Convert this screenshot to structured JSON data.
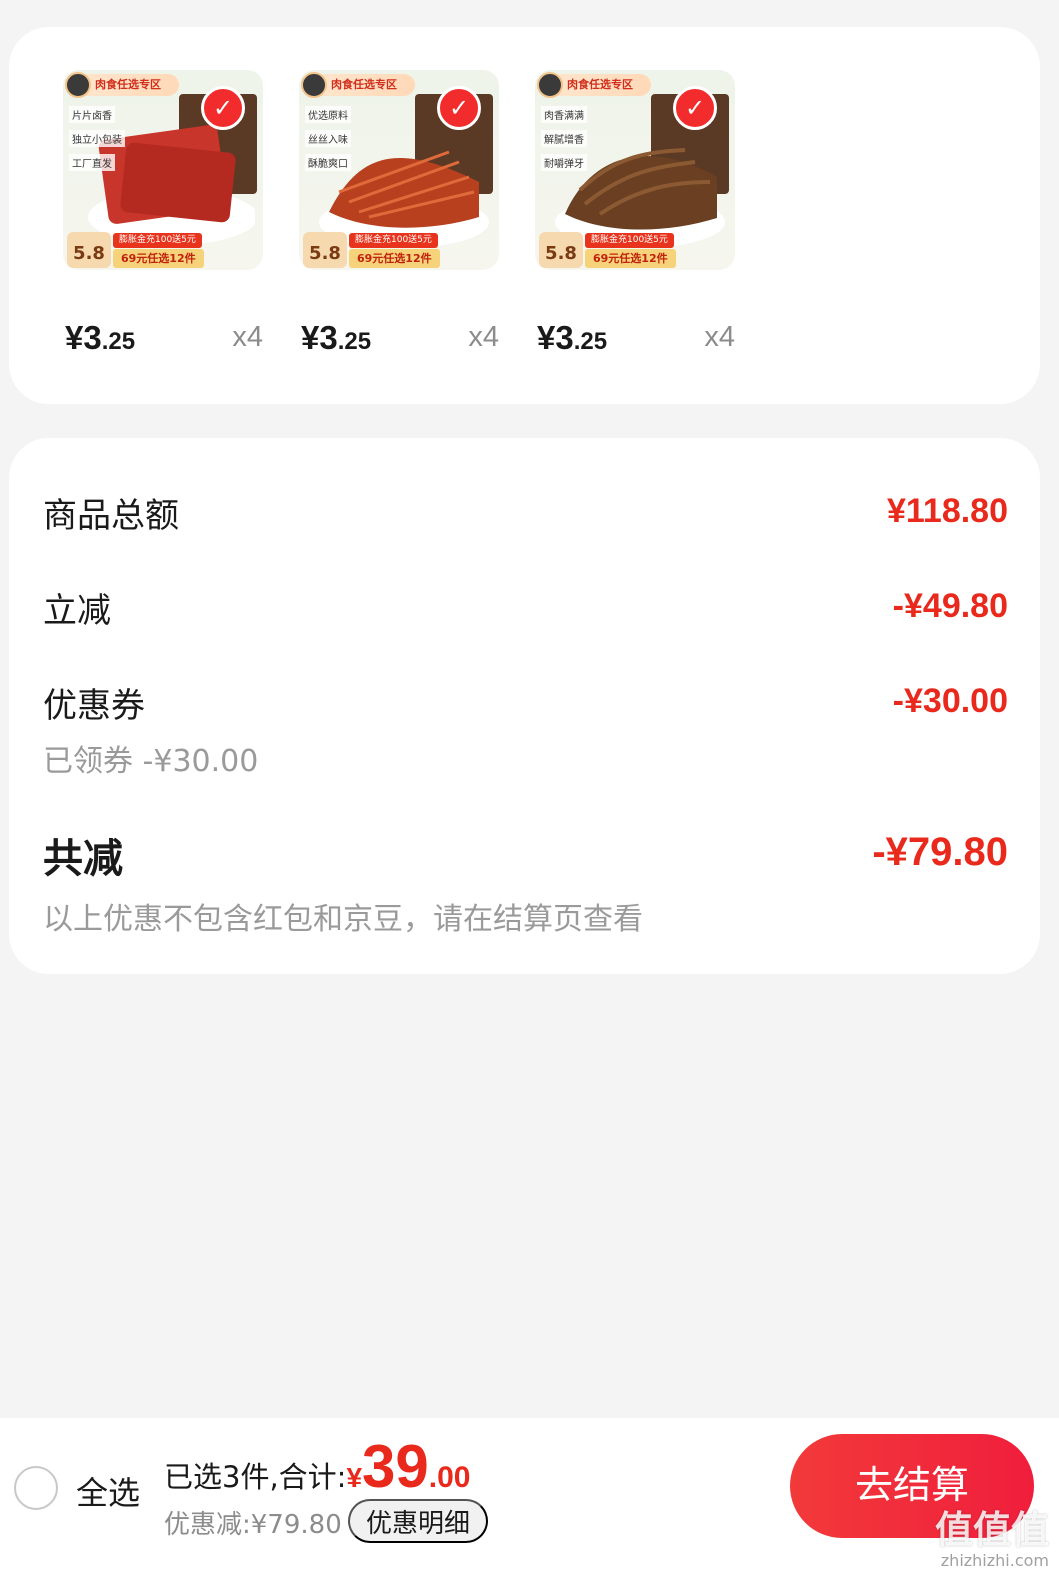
{
  "products": [
    {
      "zone_tag": "肉食任选专区",
      "features": [
        "片片卤香",
        "独立小包装",
        "工厂直发"
      ],
      "ref_price": "5.8",
      "promo_top": "膨胀金充100送5元",
      "promo_bottom": "69元任选12件",
      "price_int": "¥3",
      "price_dec": ".25",
      "qty": "x4",
      "food_color": "#c8352a",
      "selected": true
    },
    {
      "zone_tag": "肉食任选专区",
      "features": [
        "优选原料",
        "丝丝入味",
        "酥脆爽口"
      ],
      "ref_price": "5.8",
      "promo_top": "膨胀金充100送5元",
      "promo_bottom": "69元任选12件",
      "price_int": "¥3",
      "price_dec": ".25",
      "qty": "x4",
      "food_color": "#b8401e",
      "selected": true
    },
    {
      "zone_tag": "肉食任选专区",
      "features": [
        "肉香满满",
        "解腻增香",
        "耐嚼弹牙"
      ],
      "ref_price": "5.8",
      "promo_top": "膨胀金充100送5元",
      "promo_bottom": "69元任选12件",
      "price_int": "¥3",
      "price_dec": ".25",
      "qty": "x4",
      "food_color": "#6b3f22",
      "selected": true
    }
  ],
  "summary": {
    "goods_total_label": "商品总额",
    "goods_total_value": "¥118.80",
    "instant_cut_label": "立减",
    "instant_cut_value": "-¥49.80",
    "coupon_label": "优惠券",
    "coupon_value": "-¥30.00",
    "coupon_sub": "已领券 -¥30.00",
    "total_cut_label": "共减",
    "total_cut_value": "-¥79.80",
    "note": "以上优惠不包含红包和京豆，请在结算页查看"
  },
  "bottom_bar": {
    "select_all": "全选",
    "selected_text": "已选3件,合计:",
    "currency": "¥",
    "total_int": "39",
    "total_dec": ".00",
    "discount_text": "优惠减:¥79.80",
    "detail_button": "优惠明细",
    "checkout_button": "去结算"
  },
  "watermark": {
    "logo": "值值值",
    "site": "zhizhizhi.com"
  },
  "colors": {
    "accent_red": "#e8291c",
    "checkout_gradient_start": "#f23a3a",
    "checkout_gradient_end": "#f01e3c",
    "page_background": "#f4f4f4"
  }
}
